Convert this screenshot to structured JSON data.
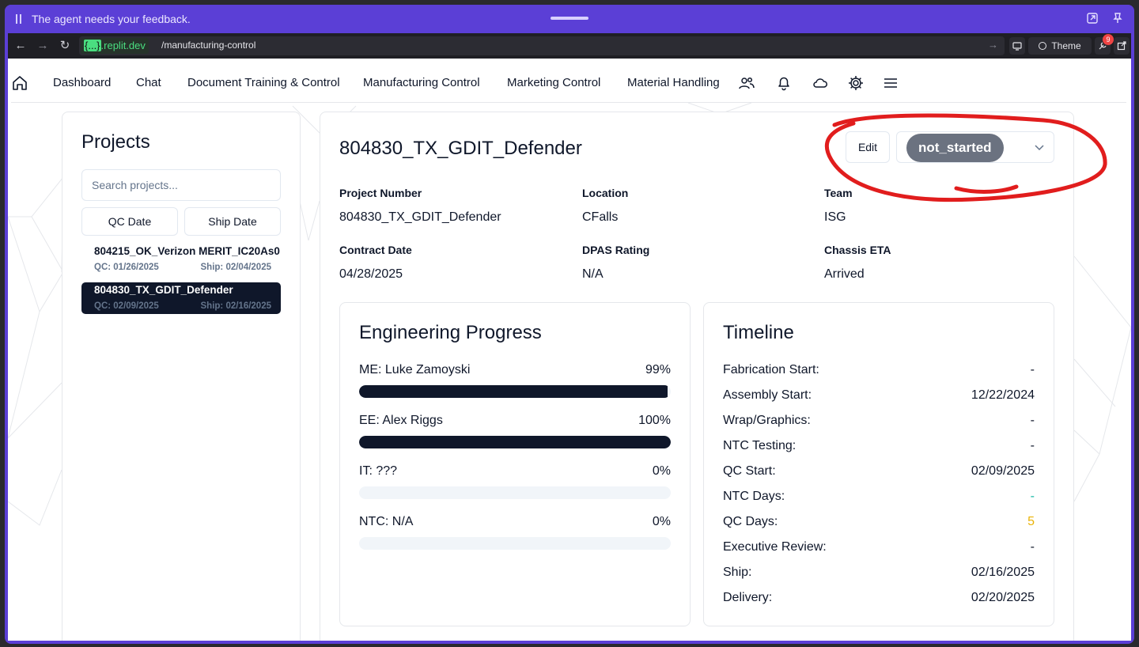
{
  "feedback_bar": {
    "message": "The agent needs your feedback."
  },
  "browser": {
    "host_prefix": "{...}",
    "host_suffix": ".replit.dev",
    "path": "/manufacturing-control",
    "theme_label": "Theme",
    "notification_count": "9"
  },
  "nav": {
    "links": [
      "Dashboard",
      "Chat",
      "Document Training & Control",
      "Manufacturing Control",
      "Marketing Control",
      "Material Handling"
    ]
  },
  "projects": {
    "title": "Projects",
    "search_placeholder": "Search projects...",
    "sort_qc": "QC Date",
    "sort_ship": "Ship Date",
    "items": [
      {
        "name": "804215_OK_Verizon MERIT_IC20As0",
        "qc": "QC: 01/26/2025",
        "ship": "Ship: 02/04/2025",
        "selected": false
      },
      {
        "name": "804830_TX_GDIT_Defender",
        "qc": "QC: 02/09/2025",
        "ship": "Ship: 02/16/2025",
        "selected": true
      }
    ]
  },
  "detail": {
    "title": "804830_TX_GDIT_Defender",
    "edit_label": "Edit",
    "status": "not_started",
    "fields": [
      {
        "label": "Project Number",
        "value": "804830_TX_GDIT_Defender"
      },
      {
        "label": "Location",
        "value": "CFalls"
      },
      {
        "label": "Team",
        "value": "ISG"
      },
      {
        "label": "Contract Date",
        "value": "04/28/2025"
      },
      {
        "label": "DPAS Rating",
        "value": "N/A"
      },
      {
        "label": "Chassis ETA",
        "value": "Arrived"
      }
    ],
    "engineering": {
      "title": "Engineering Progress",
      "rows": [
        {
          "label": "ME: Luke Zamoyski",
          "pct_text": "99%",
          "progress": 0.99
        },
        {
          "label": "EE: Alex Riggs",
          "pct_text": "100%",
          "progress": 1.0
        },
        {
          "label": "IT: ???",
          "pct_text": "0%",
          "progress": 0
        },
        {
          "label": "NTC: N/A",
          "pct_text": "0%",
          "progress": 0
        }
      ]
    },
    "timeline": {
      "title": "Timeline",
      "rows": [
        {
          "label": "Fabrication Start:",
          "value": "-",
          "color": "#0f172a"
        },
        {
          "label": "Assembly Start:",
          "value": "12/22/2024",
          "color": "#0f172a"
        },
        {
          "label": "Wrap/Graphics:",
          "value": "-",
          "color": "#0f172a"
        },
        {
          "label": "NTC Testing:",
          "value": "-",
          "color": "#0f172a"
        },
        {
          "label": "QC Start:",
          "value": "02/09/2025",
          "color": "#0f172a"
        },
        {
          "label": "NTC Days:",
          "value": "-",
          "color": "#14b8a6"
        },
        {
          "label": "QC Days:",
          "value": "5",
          "color": "#eab308"
        },
        {
          "label": "Executive Review:",
          "value": "-",
          "color": "#0f172a"
        },
        {
          "label": "Ship:",
          "value": "02/16/2025",
          "color": "#0f172a"
        },
        {
          "label": "Delivery:",
          "value": "02/20/2025",
          "color": "#0f172a"
        }
      ]
    }
  }
}
